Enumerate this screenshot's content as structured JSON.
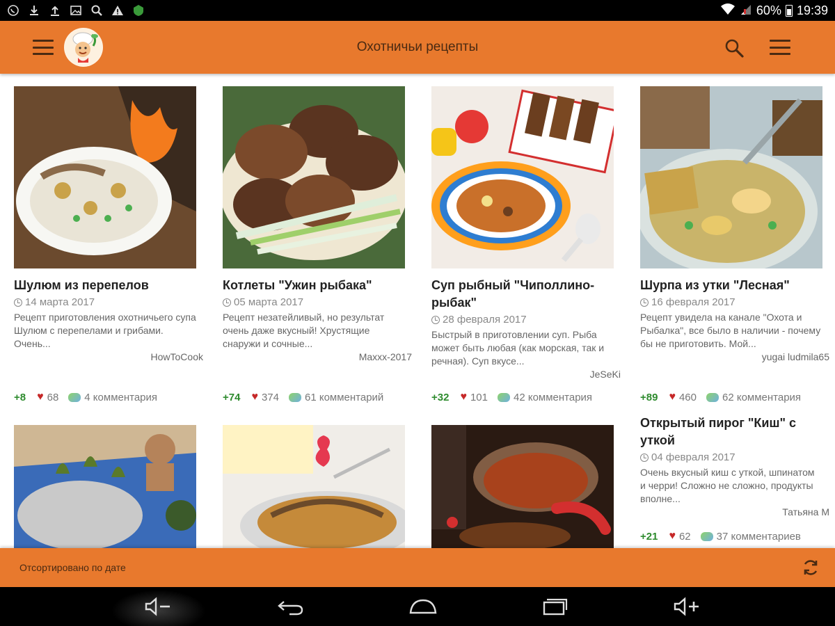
{
  "status_bar": {
    "battery": "60%",
    "time": "19:39",
    "icons": [
      "whatsapp-icon",
      "download-icon",
      "upload-icon",
      "image-icon",
      "search-icon",
      "warning-icon",
      "shield-icon"
    ]
  },
  "app_bar": {
    "title": "Охотничьи рецепты",
    "icons": [
      "menu-icon",
      "chef-logo",
      "search-icon",
      "overflow-menu-icon"
    ]
  },
  "recipes": [
    {
      "title": "Шулюм из перепелов",
      "date": "14 марта 2017",
      "description": "Рецепт приготовления охотничьего супа Шулюм с перепелами и грибами. Очень...",
      "author": "HowToCook",
      "votes": "+8",
      "likes": "68",
      "comments": "4 комментария",
      "colors": [
        "#6b4a2e",
        "#e9e4d6",
        "#c9a24a"
      ]
    },
    {
      "title": "Котлеты \"Ужин рыбака\"",
      "date": "05 марта 2017",
      "description": "Рецепт незатейливый, но результат очень даже вкусный! Хрустящие снаружи и сочные...",
      "author": "Maxxx-2017",
      "votes": "+74",
      "likes": "374",
      "comments": "61 комментарий",
      "colors": [
        "#5a3420",
        "#7b4a2b",
        "#9fcf6a"
      ]
    },
    {
      "title": "Суп рыбный \"Чиполлино-рыбак\"",
      "date": "28 февраля 2017",
      "description": "Быстрый в приготовлении суп. Рыба может быть любая (как морская, так и речная). Суп вкусе...",
      "author": "JeSeKi",
      "votes": "+32",
      "likes": "101",
      "comments": "42 комментария",
      "colors": [
        "#f2ece6",
        "#c9702a",
        "#e53935"
      ]
    },
    {
      "title": "Шурпа из утки \"Лесная\"",
      "date": "16 февраля 2017",
      "description": "Рецепт увидела на канале \"Охота и Рыбалка\", все было в наличии - почему бы не приготовить. Мой...",
      "author": "yugai ludmila65",
      "votes": "+89",
      "likes": "460",
      "comments": "62 комментария",
      "colors": [
        "#b8c7cc",
        "#c9a34a",
        "#6a4a2a"
      ]
    },
    {
      "title": "Открытый пирог \"Киш\" с уткой",
      "date": "04 февраля 2017",
      "description": "Очень вкусный киш с уткой, шпинатом и черри! Сложно не сложно, продукты вполне...",
      "author": "Татьяна М",
      "votes": "+21",
      "likes": "62",
      "comments": "37 комментариев",
      "colors": [
        "#ffffff",
        "#ffffff",
        "#ffffff"
      ]
    }
  ],
  "partial_images": [
    {
      "colors": [
        "#cfb794",
        "#3a6bb8",
        "#5a7a2a"
      ]
    },
    {
      "colors": [
        "#f0ede8",
        "#c58a3a",
        "#e53950"
      ]
    },
    {
      "colors": [
        "#2a1a12",
        "#a8421c",
        "#d32f2f"
      ]
    }
  ],
  "bottom_bar": {
    "sort_label": "Отсортировано по дате",
    "refresh_icon": "refresh-icon"
  },
  "nav_bar": {
    "icons": [
      "volume-down-icon",
      "back-icon",
      "home-icon",
      "recents-icon",
      "volume-up-icon"
    ]
  }
}
